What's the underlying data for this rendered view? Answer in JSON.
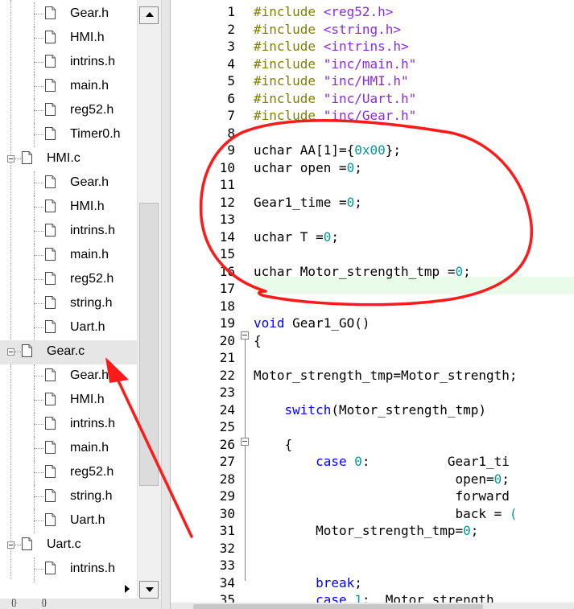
{
  "tree": {
    "items": [
      {
        "label": "Gear.h",
        "level": 2
      },
      {
        "label": "HMI.h",
        "level": 2
      },
      {
        "label": "intrins.h",
        "level": 2
      },
      {
        "label": "main.h",
        "level": 2
      },
      {
        "label": "reg52.h",
        "level": 2
      },
      {
        "label": "Timer0.h",
        "level": 2
      },
      {
        "label": "HMI.c",
        "level": 1
      },
      {
        "label": "Gear.h",
        "level": 2
      },
      {
        "label": "HMI.h",
        "level": 2
      },
      {
        "label": "intrins.h",
        "level": 2
      },
      {
        "label": "main.h",
        "level": 2
      },
      {
        "label": "reg52.h",
        "level": 2
      },
      {
        "label": "string.h",
        "level": 2
      },
      {
        "label": "Uart.h",
        "level": 2
      },
      {
        "label": "Gear.c",
        "level": 1,
        "selected": true
      },
      {
        "label": "Gear.h",
        "level": 2
      },
      {
        "label": "HMI.h",
        "level": 2
      },
      {
        "label": "intrins.h",
        "level": 2
      },
      {
        "label": "main.h",
        "level": 2
      },
      {
        "label": "reg52.h",
        "level": 2
      },
      {
        "label": "string.h",
        "level": 2
      },
      {
        "label": "Uart.h",
        "level": 2
      },
      {
        "label": "Uart.c",
        "level": 1
      },
      {
        "label": "intrins.h",
        "level": 2
      }
    ]
  },
  "bottom_tabs": [
    "{}",
    "{}"
  ],
  "editor": {
    "lines": [
      {
        "n": "1",
        "segs": [
          [
            "inc",
            "#include "
          ],
          [
            "str",
            "<reg52.h>"
          ]
        ]
      },
      {
        "n": "2",
        "segs": [
          [
            "inc",
            "#include "
          ],
          [
            "str",
            "<string.h>"
          ]
        ]
      },
      {
        "n": "3",
        "segs": [
          [
            "inc",
            "#include "
          ],
          [
            "str",
            "<intrins.h>"
          ]
        ]
      },
      {
        "n": "4",
        "segs": [
          [
            "inc",
            "#include "
          ],
          [
            "str",
            "\"inc/main.h\""
          ]
        ]
      },
      {
        "n": "5",
        "segs": [
          [
            "inc",
            "#include "
          ],
          [
            "str",
            "\"inc/HMI.h\""
          ]
        ]
      },
      {
        "n": "6",
        "segs": [
          [
            "inc",
            "#include "
          ],
          [
            "str",
            "\"inc/Uart.h\""
          ]
        ]
      },
      {
        "n": "7",
        "segs": [
          [
            "inc",
            "#include "
          ],
          [
            "str",
            "\"inc/Gear.h\""
          ]
        ]
      },
      {
        "n": "8",
        "segs": []
      },
      {
        "n": "9",
        "segs": [
          [
            "",
            "uchar AA[1]={"
          ],
          [
            "num",
            "0x00"
          ],
          [
            "",
            "};"
          ]
        ]
      },
      {
        "n": "10",
        "segs": [
          [
            "",
            "uchar open ="
          ],
          [
            "num",
            "0"
          ],
          [
            "",
            ";"
          ]
        ]
      },
      {
        "n": "11",
        "segs": []
      },
      {
        "n": "12",
        "segs": [
          [
            "",
            "Gear1_time ="
          ],
          [
            "num",
            "0"
          ],
          [
            "",
            ";"
          ]
        ]
      },
      {
        "n": "13",
        "segs": []
      },
      {
        "n": "14",
        "segs": [
          [
            "",
            "uchar T ="
          ],
          [
            "num",
            "0"
          ],
          [
            "",
            ";"
          ]
        ]
      },
      {
        "n": "15",
        "segs": []
      },
      {
        "n": "16",
        "segs": [
          [
            "",
            "uchar Motor_strength_tmp ="
          ],
          [
            "num",
            "0"
          ],
          [
            "",
            ";"
          ]
        ]
      },
      {
        "n": "17",
        "segs": []
      },
      {
        "n": "18",
        "segs": []
      },
      {
        "n": "19",
        "segs": [
          [
            "kw",
            "void"
          ],
          [
            "",
            " Gear1_GO()"
          ]
        ]
      },
      {
        "n": "20",
        "segs": [
          [
            "",
            "{"
          ]
        ]
      },
      {
        "n": "21",
        "segs": []
      },
      {
        "n": "22",
        "segs": [
          [
            "",
            "Motor_strength_tmp=Motor_strength;"
          ]
        ]
      },
      {
        "n": "23",
        "segs": []
      },
      {
        "n": "24",
        "segs": [
          [
            "",
            "    "
          ],
          [
            "kw",
            "switch"
          ],
          [
            "",
            "(Motor_strength_tmp)"
          ]
        ]
      },
      {
        "n": "25",
        "segs": []
      },
      {
        "n": "26",
        "segs": [
          [
            "",
            "    {"
          ]
        ]
      },
      {
        "n": "27",
        "segs": [
          [
            "",
            "        "
          ],
          [
            "kw",
            "case"
          ],
          [
            "",
            " "
          ],
          [
            "num",
            "0"
          ],
          [
            "",
            ":          Gear1_ti"
          ]
        ]
      },
      {
        "n": "28",
        "segs": [
          [
            "",
            "                          open="
          ],
          [
            "num",
            "0"
          ],
          [
            "",
            ";"
          ]
        ]
      },
      {
        "n": "29",
        "segs": [
          [
            "",
            "                          forward"
          ]
        ]
      },
      {
        "n": "30",
        "segs": [
          [
            "",
            "                          back = "
          ],
          [
            "num",
            "("
          ]
        ]
      },
      {
        "n": "31",
        "segs": [
          [
            "",
            "        Motor_strength_tmp="
          ],
          [
            "num",
            "0"
          ],
          [
            "",
            ";"
          ]
        ]
      },
      {
        "n": "32",
        "segs": []
      },
      {
        "n": "33",
        "segs": []
      },
      {
        "n": "34",
        "segs": [
          [
            "",
            "        "
          ],
          [
            "kw",
            "break"
          ],
          [
            "",
            ";"
          ]
        ]
      },
      {
        "n": "35",
        "segs": [
          [
            "",
            "        "
          ],
          [
            "kw",
            "case"
          ],
          [
            "",
            " "
          ],
          [
            "num",
            "1"
          ],
          [
            "",
            ":  Motor_strength_"
          ]
        ]
      }
    ]
  },
  "colors": {
    "include": "#808000",
    "string": "#8a2be2",
    "number": "#009a9a",
    "keyword": "#0000ff",
    "current_line": "#e9fbe9",
    "annotation": "#ff1a1a"
  }
}
